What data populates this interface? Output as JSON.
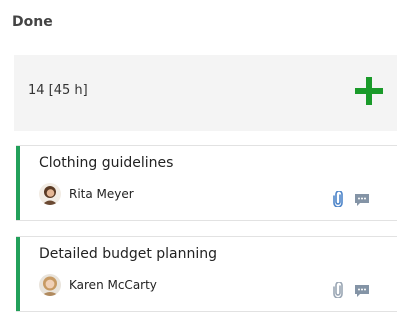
{
  "column": {
    "title": "Done",
    "summary": "14 [45 h]",
    "add_icon": "plus-icon",
    "accent_color": "#22a05a",
    "add_color": "#1a9a2a"
  },
  "cards": [
    {
      "title": "Clothing guidelines",
      "assignee": "Rita Meyer",
      "attachment_icon": "paperclip-icon",
      "comment_icon": "comment-icon"
    },
    {
      "title": "Detailed budget planning",
      "assignee": "Karen McCarty",
      "attachment_icon": "paperclip-icon",
      "comment_icon": "comment-icon"
    }
  ]
}
